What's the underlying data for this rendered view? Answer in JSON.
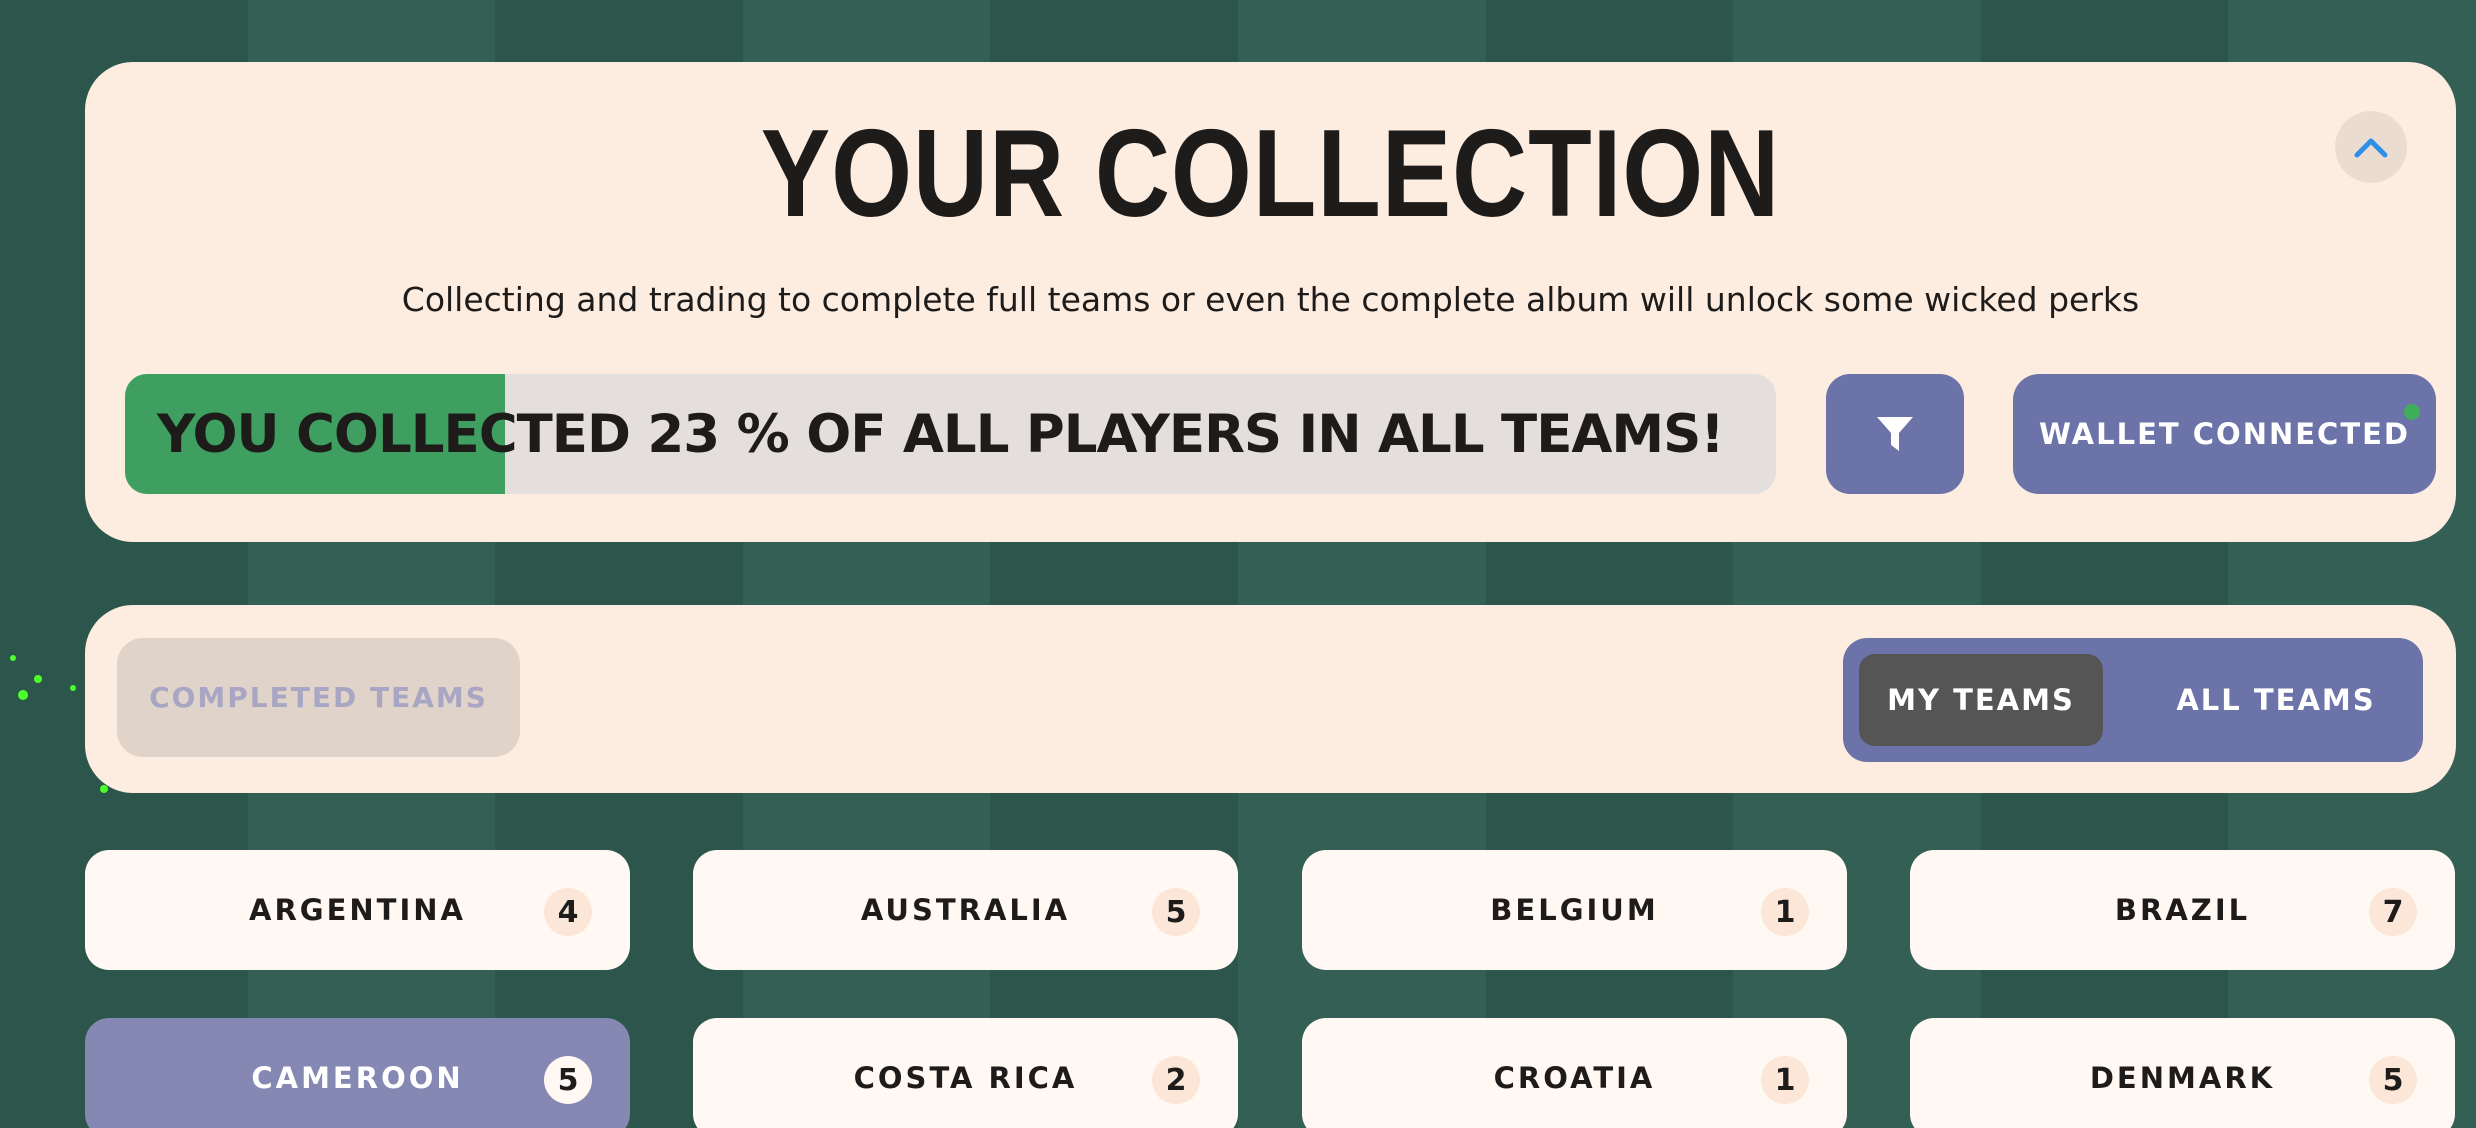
{
  "header": {
    "title": "YOUR COLLECTION",
    "subtitle": "Collecting and trading to complete full teams or even the complete album will unlock some wicked perks",
    "collapse_icon": "chevron-up-icon"
  },
  "progress": {
    "text": "YOU COLLECTED 23 % OF ALL PLAYERS IN ALL TEAMS!",
    "percent": 23
  },
  "toolbar": {
    "filter_icon": "filter-icon",
    "wallet_label": "WALLET CONNECTED",
    "wallet_status": "connected"
  },
  "tabs": {
    "completed_label": "COMPLETED TEAMS",
    "my_teams_label": "MY TEAMS",
    "all_teams_label": "ALL TEAMS",
    "active": "MY TEAMS"
  },
  "teams": [
    {
      "name": "ARGENTINA",
      "count": "4",
      "selected": false
    },
    {
      "name": "AUSTRALIA",
      "count": "5",
      "selected": false
    },
    {
      "name": "BELGIUM",
      "count": "1",
      "selected": false
    },
    {
      "name": "BRAZIL",
      "count": "7",
      "selected": false
    },
    {
      "name": "CAMEROON",
      "count": "5",
      "selected": true
    },
    {
      "name": "COSTA RICA",
      "count": "2",
      "selected": false
    },
    {
      "name": "CROATIA",
      "count": "1",
      "selected": false
    },
    {
      "name": "DENMARK",
      "count": "5",
      "selected": false
    }
  ],
  "colors": {
    "panel": "#fdece0",
    "accent": "#6b73a8",
    "progress_fill": "#3f9f60",
    "selected_card": "#8488b2"
  }
}
